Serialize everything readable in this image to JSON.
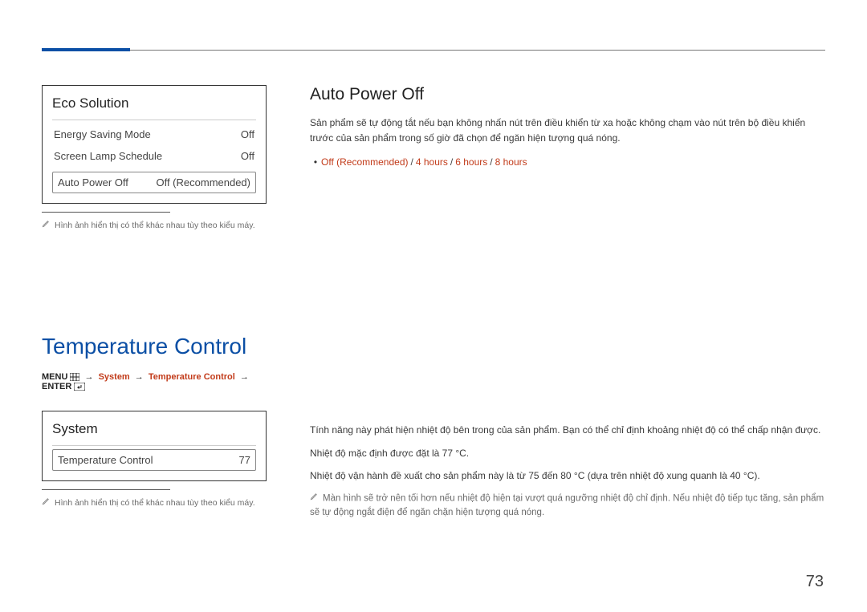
{
  "page_number": "73",
  "eco_panel": {
    "title": "Eco Solution",
    "rows": [
      {
        "label": "Energy Saving Mode",
        "value": "Off"
      },
      {
        "label": "Screen Lamp Schedule",
        "value": "Off"
      }
    ],
    "selected": {
      "label": "Auto Power Off",
      "value": "Off (Recommended)"
    }
  },
  "note1": "Hình ảnh hiển thị có thể khác nhau tùy theo kiểu máy.",
  "section_heading": "Temperature Control",
  "breadcrumb": {
    "menu": "MENU",
    "system": "System",
    "tc": "Temperature Control",
    "enter": "ENTER"
  },
  "system_panel": {
    "title": "System",
    "row": {
      "label": "Temperature Control",
      "value": "77"
    }
  },
  "note2": "Hình ảnh hiển thị có thể khác nhau tùy theo kiểu máy.",
  "right": {
    "apo_title": "Auto Power Off",
    "apo_desc": "Sản phẩm sẽ tự động tắt nếu bạn không nhấn nút trên điều khiển từ xa hoặc không chạm vào nút trên bộ điều khiển trước của sản phẩm trong số giờ đã chọn để ngăn hiện tượng quá nóng.",
    "apo_options": [
      "Off (Recommended)",
      "4 hours",
      "6 hours",
      "8 hours"
    ],
    "tc_p1": "Tính năng này phát hiện nhiệt độ bên trong của sản phẩm. Bạn có thể chỉ định khoảng nhiệt độ có thể chấp nhận được.",
    "tc_p2": "Nhiệt độ mặc định được đặt là 77 °C.",
    "tc_p3": "Nhiệt độ vận hành đề xuất cho sản phẩm này là từ 75 đến 80 °C (dựa trên nhiệt độ xung quanh là 40 °C).",
    "tc_note": "Màn hình sẽ trở nên tối hơn nếu nhiệt độ hiện tại vượt quá ngưỡng nhiệt độ chỉ định. Nếu nhiệt độ tiếp tục tăng, sản phẩm sẽ tự động ngắt điện để ngăn chặn hiện tượng quá nóng."
  }
}
